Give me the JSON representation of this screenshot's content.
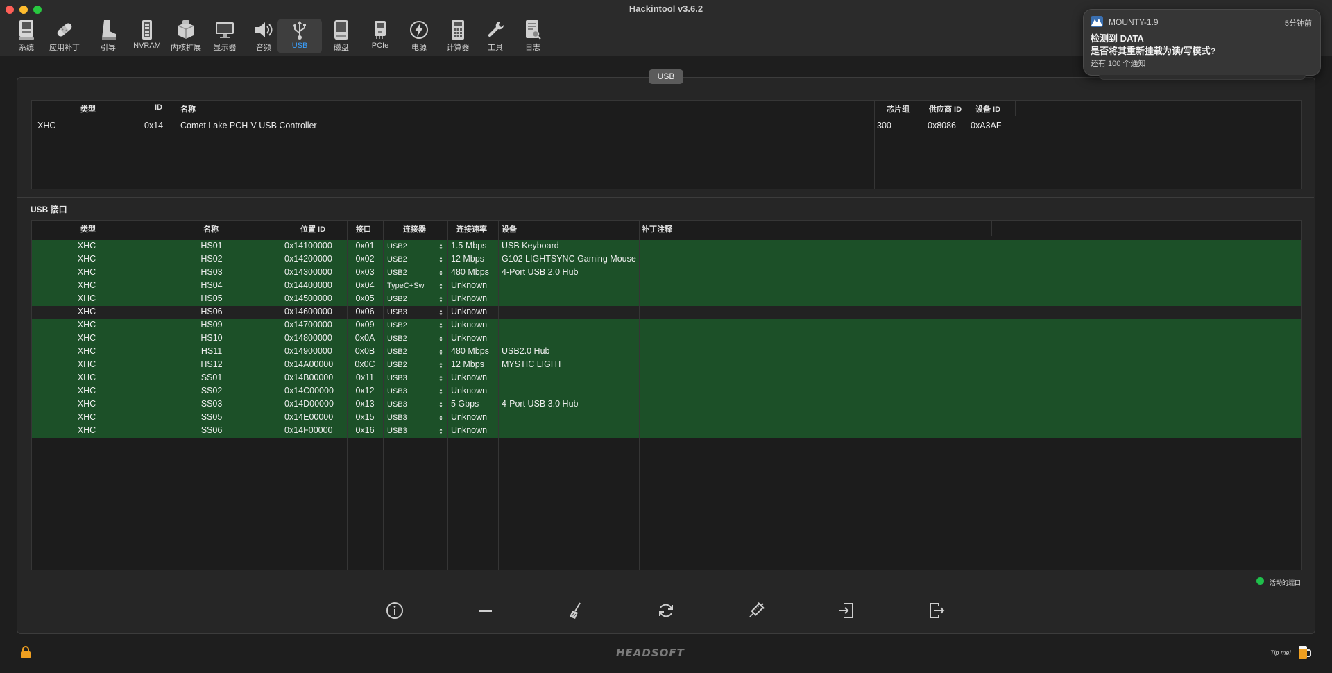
{
  "window": {
    "title": "Hackintool v3.6.2"
  },
  "toolbar": {
    "items": [
      {
        "label": "系统",
        "icon": "computer-icon"
      },
      {
        "label": "应用补丁",
        "icon": "bandage-icon"
      },
      {
        "label": "引导",
        "icon": "boot-icon"
      },
      {
        "label": "NVRAM",
        "icon": "nvram-chip-icon"
      },
      {
        "label": "内核扩展",
        "icon": "kext-box-icon"
      },
      {
        "label": "显示器",
        "icon": "display-icon"
      },
      {
        "label": "音频",
        "icon": "speaker-icon"
      },
      {
        "label": "USB",
        "icon": "usb-icon",
        "active": true
      },
      {
        "label": "磁盘",
        "icon": "disk-icon"
      },
      {
        "label": "PCIe",
        "icon": "pcie-card-icon"
      },
      {
        "label": "电源",
        "icon": "power-bolt-icon"
      },
      {
        "label": "计算器",
        "icon": "calculator-icon"
      },
      {
        "label": "工具",
        "icon": "wrench-icon"
      },
      {
        "label": "日志",
        "icon": "log-icon"
      }
    ]
  },
  "notification": {
    "app": "MOUNTY-1.9",
    "time": "5分钟前",
    "title": "检测到 DATA",
    "body": "是否将其重新挂载为读/写模式?",
    "more": "还有 100 个通知"
  },
  "panel_tab": "USB",
  "controllers": {
    "headers": {
      "type": "类型",
      "id": "ID",
      "name": "名称",
      "chipset": "芯片组",
      "vendor": "供应商 ID",
      "device": "设备 ID"
    },
    "rows": [
      {
        "type": "XHC",
        "id": "0x14",
        "name": "Comet Lake PCH-V USB Controller",
        "chipset": "300",
        "vendor": "0x8086",
        "device": "0xA3AF"
      }
    ]
  },
  "ports_section_label": "USB 接口",
  "ports": {
    "headers": {
      "type": "类型",
      "name": "名称",
      "location": "位置 ID",
      "port": "接口",
      "connector": "连接器",
      "speed": "连接速率",
      "device": "设备",
      "comment": "补丁注释"
    },
    "rows": [
      {
        "type": "XHC",
        "name": "HS01",
        "location": "0x14100000",
        "port": "0x01",
        "connector": "USB2",
        "speed": "1.5 Mbps",
        "device": "USB Keyboard",
        "comment": "",
        "active": true
      },
      {
        "type": "XHC",
        "name": "HS02",
        "location": "0x14200000",
        "port": "0x02",
        "connector": "USB2",
        "speed": "12 Mbps",
        "device": "G102 LIGHTSYNC Gaming Mouse",
        "comment": "",
        "active": true
      },
      {
        "type": "XHC",
        "name": "HS03",
        "location": "0x14300000",
        "port": "0x03",
        "connector": "USB2",
        "speed": "480 Mbps",
        "device": "4-Port USB 2.0 Hub",
        "comment": "",
        "active": true
      },
      {
        "type": "XHC",
        "name": "HS04",
        "location": "0x14400000",
        "port": "0x04",
        "connector": "TypeC+Sw",
        "speed": "Unknown",
        "device": "",
        "comment": "",
        "active": true
      },
      {
        "type": "XHC",
        "name": "HS05",
        "location": "0x14500000",
        "port": "0x05",
        "connector": "USB2",
        "speed": "Unknown",
        "device": "",
        "comment": "",
        "active": true
      },
      {
        "type": "XHC",
        "name": "HS06",
        "location": "0x14600000",
        "port": "0x06",
        "connector": "USB3",
        "speed": "Unknown",
        "device": "",
        "comment": "",
        "active": false
      },
      {
        "type": "XHC",
        "name": "HS09",
        "location": "0x14700000",
        "port": "0x09",
        "connector": "USB2",
        "speed": "Unknown",
        "device": "",
        "comment": "",
        "active": true
      },
      {
        "type": "XHC",
        "name": "HS10",
        "location": "0x14800000",
        "port": "0x0A",
        "connector": "USB2",
        "speed": "Unknown",
        "device": "",
        "comment": "",
        "active": true
      },
      {
        "type": "XHC",
        "name": "HS11",
        "location": "0x14900000",
        "port": "0x0B",
        "connector": "USB2",
        "speed": "480 Mbps",
        "device": "USB2.0 Hub",
        "comment": "",
        "active": true
      },
      {
        "type": "XHC",
        "name": "HS12",
        "location": "0x14A00000",
        "port": "0x0C",
        "connector": "USB2",
        "speed": "12 Mbps",
        "device": "MYSTIC LIGHT",
        "comment": "",
        "active": true
      },
      {
        "type": "XHC",
        "name": "SS01",
        "location": "0x14B00000",
        "port": "0x11",
        "connector": "USB3",
        "speed": "Unknown",
        "device": "",
        "comment": "",
        "active": true
      },
      {
        "type": "XHC",
        "name": "SS02",
        "location": "0x14C00000",
        "port": "0x12",
        "connector": "USB3",
        "speed": "Unknown",
        "device": "",
        "comment": "",
        "active": true
      },
      {
        "type": "XHC",
        "name": "SS03",
        "location": "0x14D00000",
        "port": "0x13",
        "connector": "USB3",
        "speed": "5 Gbps",
        "device": "4-Port USB 3.0 Hub",
        "comment": "",
        "active": true
      },
      {
        "type": "XHC",
        "name": "SS05",
        "location": "0x14E00000",
        "port": "0x15",
        "connector": "USB3",
        "speed": "Unknown",
        "device": "",
        "comment": "",
        "active": true
      },
      {
        "type": "XHC",
        "name": "SS06",
        "location": "0x14F00000",
        "port": "0x16",
        "connector": "USB3",
        "speed": "Unknown",
        "device": "",
        "comment": "",
        "active": true
      }
    ]
  },
  "legend": {
    "label": "活动的端口",
    "color": "#1fbf4b"
  },
  "colors": {
    "active_row": "#1c5028",
    "inactive_row": "#222222",
    "accent": "#3aa0ff"
  },
  "bottom_buttons": [
    {
      "name": "info-button",
      "icon": "info-icon"
    },
    {
      "name": "remove-button",
      "icon": "minus-icon"
    },
    {
      "name": "clear-button",
      "icon": "broom-icon"
    },
    {
      "name": "refresh-button",
      "icon": "refresh-icon"
    },
    {
      "name": "inject-button",
      "icon": "syringe-icon"
    },
    {
      "name": "import-button",
      "icon": "import-icon"
    },
    {
      "name": "export-button",
      "icon": "export-icon"
    }
  ],
  "footer": {
    "brand": "HEADSOFT",
    "tip": "Tip me!"
  }
}
